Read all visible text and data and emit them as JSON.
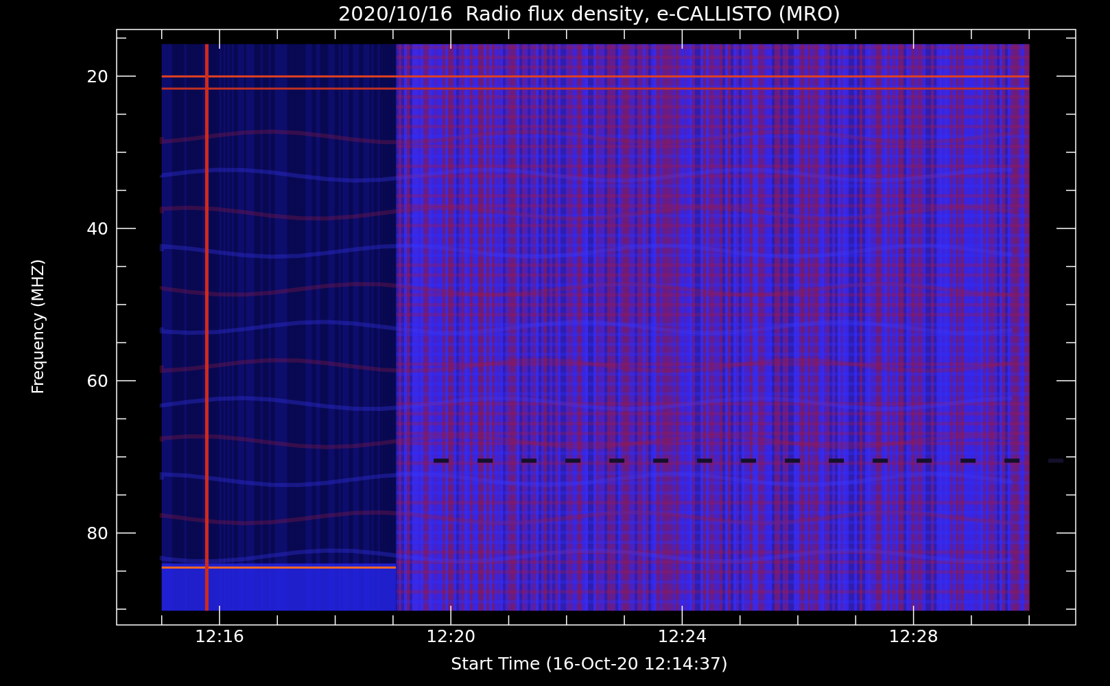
{
  "plot": {
    "title": "2020/10/16  Radio flux density, e-CALLISTO (MRO)",
    "ylabel": "Frequency (MHZ)",
    "xlabel": "Start Time (16-Oct-20 12:14:37)",
    "yticks": [
      "20",
      "40",
      "60",
      "80"
    ],
    "xticks": [
      "12:16",
      "12:20",
      "12:24",
      "12:28"
    ]
  }
}
